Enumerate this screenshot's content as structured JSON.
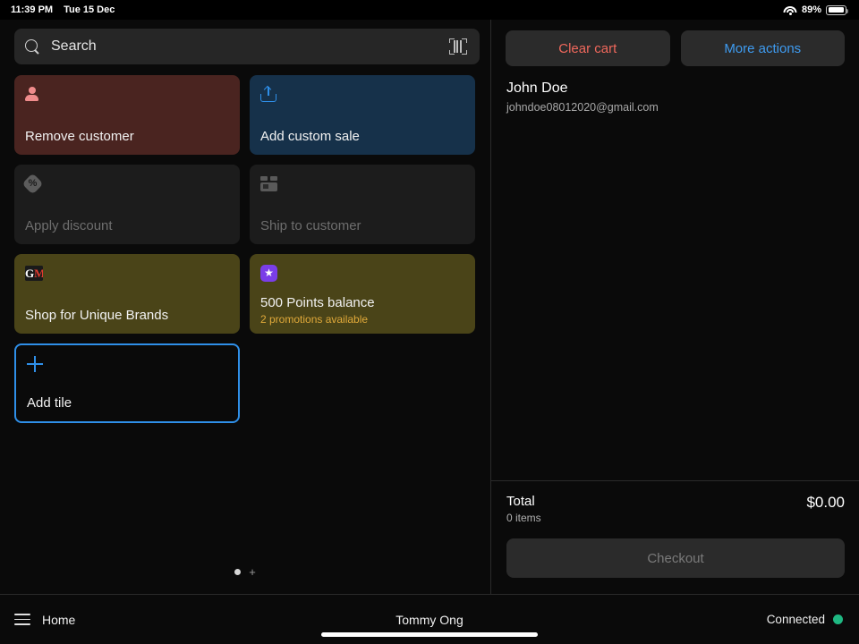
{
  "statusbar": {
    "time": "11:39 PM",
    "date": "Tue 15 Dec",
    "battery_percent": "89%",
    "wifi_icon": "wifi-icon",
    "battery_icon": "battery-icon"
  },
  "search": {
    "placeholder": "Search",
    "value": "",
    "search_icon": "search-icon",
    "scan_icon": "barcode-scan-icon"
  },
  "tiles": [
    {
      "label": "Remove customer",
      "sub": "",
      "icon": "person-icon",
      "style": "t-remove",
      "disabled": false,
      "name": "tile-remove-customer"
    },
    {
      "label": "Add custom sale",
      "sub": "",
      "icon": "upload-icon",
      "style": "t-custom",
      "disabled": false,
      "name": "tile-add-custom-sale"
    },
    {
      "label": "Apply discount",
      "sub": "",
      "icon": "discount-percent-icon",
      "style": "t-disabled",
      "disabled": true,
      "name": "tile-apply-discount"
    },
    {
      "label": "Ship to customer",
      "sub": "",
      "icon": "shipping-box-icon",
      "style": "t-disabled",
      "disabled": true,
      "name": "tile-ship-to-customer"
    },
    {
      "label": "Shop for Unique Brands",
      "sub": "",
      "icon": "gm-logo-icon",
      "style": "t-olive",
      "disabled": false,
      "name": "tile-shop-unique-brands"
    },
    {
      "label": "500 Points balance",
      "sub": "2 promotions available",
      "icon": "star-badge-icon",
      "style": "t-olive",
      "disabled": false,
      "name": "tile-points-balance"
    },
    {
      "label": "Add tile",
      "sub": "",
      "icon": "plus-icon",
      "style": "t-add",
      "disabled": false,
      "name": "tile-add-tile"
    }
  ],
  "pager": {
    "dots": 1,
    "add_page_label": "+"
  },
  "cart": {
    "clear_label": "Clear cart",
    "more_label": "More actions",
    "customer_name": "John Doe",
    "customer_email": "johndoe08012020@gmail.com",
    "total_label": "Total",
    "items_label": "0 items",
    "total_amount": "$0.00",
    "checkout_label": "Checkout"
  },
  "bottombar": {
    "home_label": "Home",
    "menu_icon": "hamburger-menu-icon",
    "staff_name": "Tommy Ong",
    "connection_label": "Connected",
    "connection_color": "#1fb882"
  },
  "colors": {
    "accent_blue": "#2f8fe8",
    "danger_red": "#f0685c",
    "tile_remove": "#4a2420",
    "tile_custom": "#16314a",
    "tile_olive": "#4a4418",
    "promo_amber": "#e0a93a",
    "purple_badge": "#7a3ee8"
  }
}
